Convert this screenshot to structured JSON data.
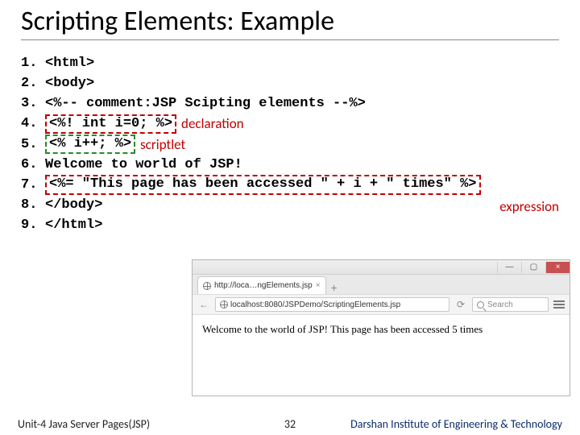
{
  "title": "Scripting Elements: Example",
  "code": {
    "lines": [
      {
        "n": "1.",
        "text": "<html>"
      },
      {
        "n": "2.",
        "text": "<body>"
      },
      {
        "n": "3.",
        "text": "<%-- comment:JSP Scipting elements --%>"
      },
      {
        "n": "4.",
        "text": "<%! int i=0; %>",
        "box": "red",
        "annot": "declaration"
      },
      {
        "n": "5.",
        "text": "<% i++; %>",
        "box": "green",
        "annot": "scriptlet"
      },
      {
        "n": "6.",
        "text": "Welcome to world of JSP!"
      },
      {
        "n": "7.",
        "text": "<%= \"This page has been accessed \" + i + \" times\" %>",
        "box": "red"
      },
      {
        "n": "8.",
        "text": "</body>",
        "annot_right": "expression"
      },
      {
        "n": "9.",
        "text": "</html>"
      }
    ]
  },
  "browser": {
    "tab_title": "http://loca…ngElements.jsp",
    "tab_close": "×",
    "tab_plus": "+",
    "url": "localhost:8080/JSPDemo/ScriptingElements.jsp",
    "nav_back": "←",
    "reload": "⟳",
    "search_placeholder": "Search",
    "win_min": "—",
    "win_max": "▢",
    "win_close": "×",
    "page_text": "Welcome to the world of JSP! This page has been accessed 5 times"
  },
  "footer": {
    "left": "Unit-4 Java Server Pages(JSP)",
    "page": "32",
    "right": "Darshan Institute of Engineering & Technology"
  }
}
